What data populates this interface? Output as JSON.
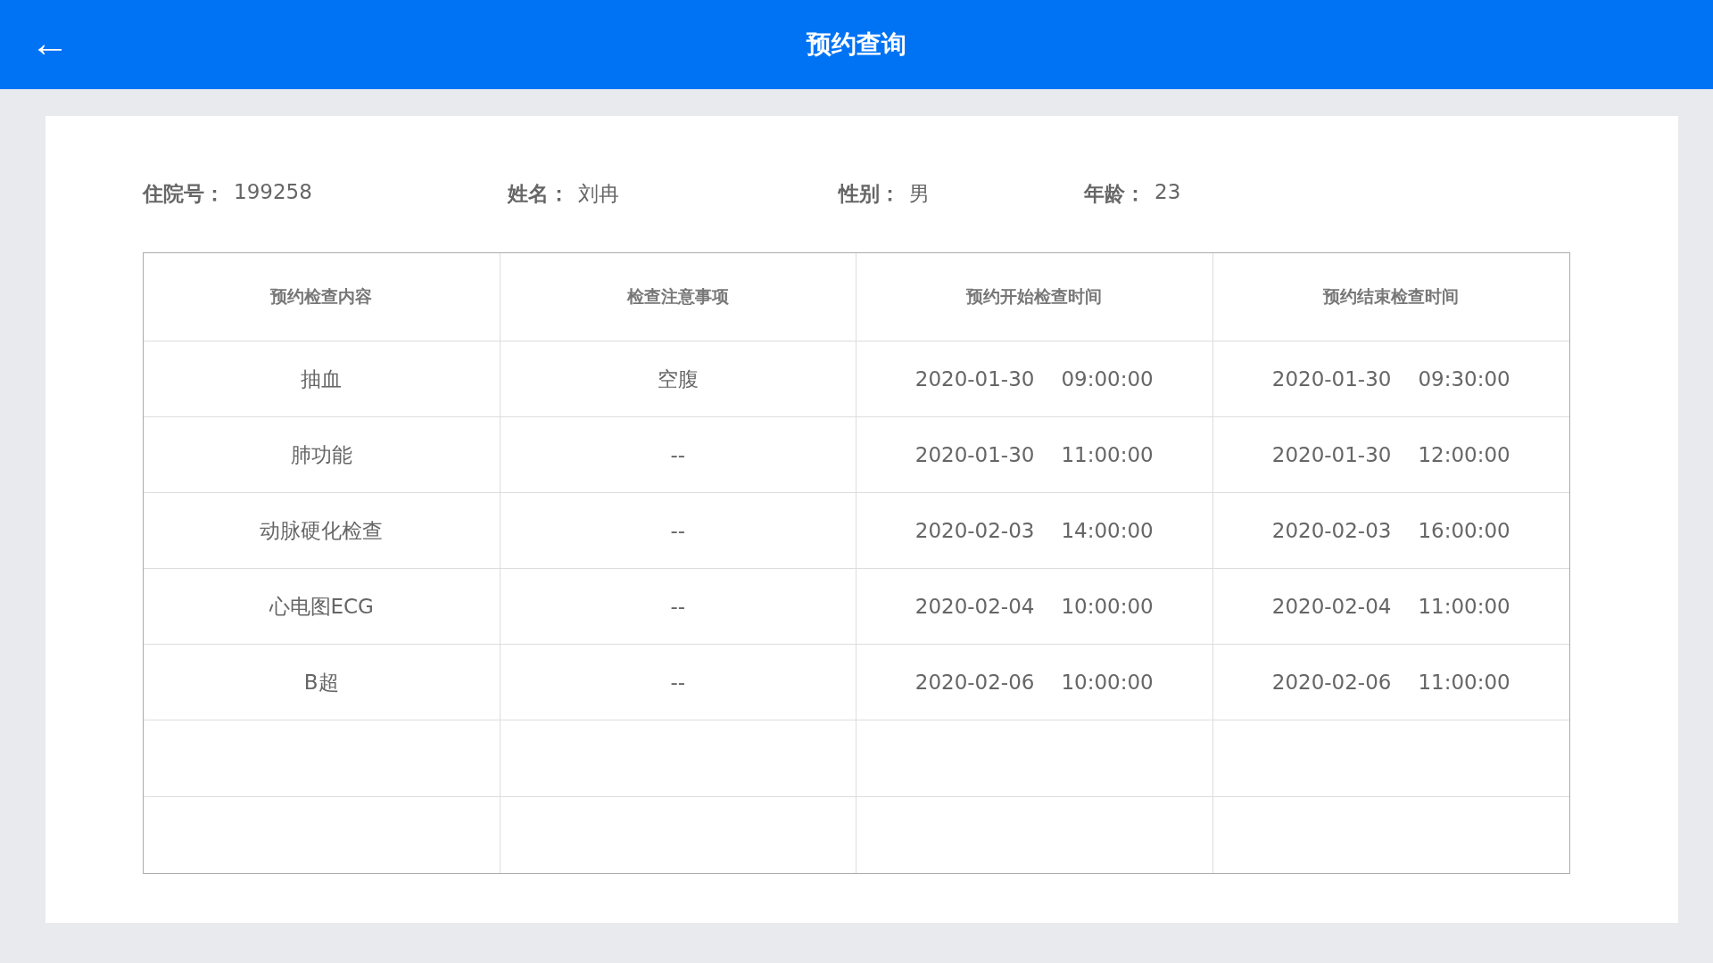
{
  "header": {
    "back": "←",
    "title": "预约查询"
  },
  "patient": [
    {
      "label": "住院号：",
      "value": "199258"
    },
    {
      "label": "姓名：",
      "value": "刘冉"
    },
    {
      "label": "性别：",
      "value": "男"
    },
    {
      "label": "年龄：",
      "value": "23"
    }
  ],
  "table": {
    "columns": [
      "预约检查内容",
      "检查注意事项",
      "预约开始检查时间",
      "预约结束检查时间"
    ],
    "rows": [
      {
        "item": "抽血",
        "note": "空腹",
        "start_date": "2020-01-30",
        "start_time": "09:00:00",
        "end_date": "2020-01-30",
        "end_time": "09:30:00"
      },
      {
        "item": "肺功能",
        "note": "--",
        "start_date": "2020-01-30",
        "start_time": "11:00:00",
        "end_date": "2020-01-30",
        "end_time": "12:00:00"
      },
      {
        "item": "动脉硬化检查",
        "note": "--",
        "start_date": "2020-02-03",
        "start_time": "14:00:00",
        "end_date": "2020-02-03",
        "end_time": "16:00:00"
      },
      {
        "item": "心电图ECG",
        "note": "--",
        "start_date": "2020-02-04",
        "start_time": "10:00:00",
        "end_date": "2020-02-04",
        "end_time": "11:00:00"
      },
      {
        "item": "B超",
        "note": "--",
        "start_date": "2020-02-06",
        "start_time": "10:00:00",
        "end_date": "2020-02-06",
        "end_time": "11:00:00"
      }
    ]
  }
}
